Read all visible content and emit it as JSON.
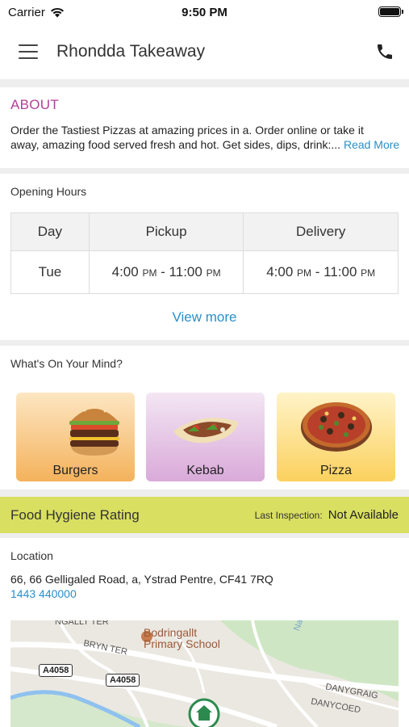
{
  "status_bar": {
    "carrier": "Carrier",
    "time": "9:50 PM"
  },
  "header": {
    "title": "Rhondda Takeaway",
    "menu_icon": "hamburger-menu-icon",
    "phone_icon": "phone-icon"
  },
  "about": {
    "heading": "ABOUT",
    "line1": "Order the Tastiest Pizzas at amazing prices in a. Order online or take it",
    "line2": "away, amazing food served fresh and hot. Get sides, dips, drink:...",
    "read_more": "Read More"
  },
  "opening_hours": {
    "label": "Opening Hours",
    "columns": [
      "Day",
      "Pickup",
      "Delivery"
    ],
    "rows": [
      {
        "day": "Tue",
        "pickup_start": "4:00",
        "pickup_start_ampm": "PM",
        "pickup_sep": " - ",
        "pickup_end": "11:00",
        "pickup_end_ampm": "PM",
        "delivery_start": "4:00",
        "delivery_start_ampm": "PM",
        "delivery_sep": " - ",
        "delivery_end": "11:00",
        "delivery_end_ampm": "PM"
      }
    ],
    "view_more": "View more"
  },
  "whats_on_mind": {
    "label": "What's On Your Mind?",
    "categories": [
      {
        "label": "Burgers",
        "icon": "burger-image"
      },
      {
        "label": "Kebab",
        "icon": "kebab-image"
      },
      {
        "label": "Pizza",
        "icon": "pizza-image"
      }
    ]
  },
  "hygiene": {
    "title": "Food Hygiene Rating",
    "last_label": "Last Inspection:",
    "last_value": "Not Available",
    "color": "#d9df60"
  },
  "location": {
    "label": "Location",
    "address": "66, 66 Gelligaled Road, a, Ystrad Pentre, CF41 7RQ",
    "phone": "1443 440000",
    "map": {
      "labels": [
        "NGALLT TER",
        "BRYN TER",
        "DANYGRAIG",
        "DANYCOED",
        "Na"
      ],
      "school": [
        "Bodringallt",
        "Primary School"
      ],
      "road_shields": [
        "A4058",
        "A4058"
      ]
    }
  },
  "colors": {
    "accent": "#b1409a",
    "link": "#2a8fc7",
    "divider": "#eeeeee"
  }
}
